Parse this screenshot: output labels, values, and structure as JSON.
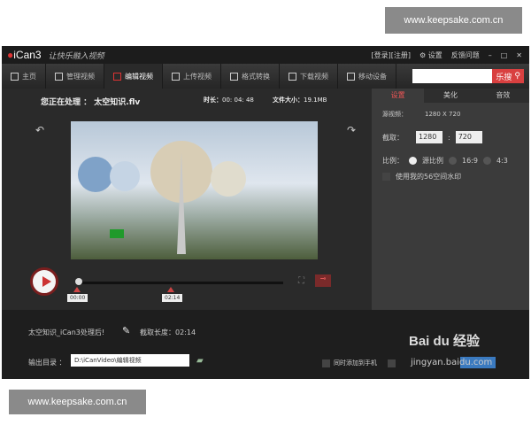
{
  "watermark_top": "www.keepsake.com.cn",
  "watermark_bottom": "www.keepsake.com.cn",
  "app": {
    "logo": "iCan3",
    "slogan": "让快乐融入视频",
    "login": "[登录]",
    "register": "[注册]",
    "settings": "设置",
    "feedback": "反馈问题"
  },
  "tabs": [
    {
      "label": "主页"
    },
    {
      "label": "管理视频"
    },
    {
      "label": "编辑视频"
    },
    {
      "label": "上传视频"
    },
    {
      "label": "格式转换"
    },
    {
      "label": "下载视频"
    },
    {
      "label": "移动设备"
    }
  ],
  "search": {
    "button": "乐搜",
    "value": ""
  },
  "info": {
    "processing_label": "您正在处理 ：",
    "file": "太空知识.flv",
    "duration_label": "时长：",
    "duration": "00: 04: 48",
    "size_label": "文件大小：",
    "size": "19.1MB"
  },
  "right_panel": {
    "tabs": [
      "设置",
      "美化",
      "音效"
    ],
    "source_label": "源视频：",
    "source": "1280 X 720",
    "crop_label": "截取：",
    "crop_w": "1280",
    "crop_h": "720",
    "ratio_label": "比例：",
    "ratios": [
      "源比例",
      "16:9",
      "4:3"
    ],
    "watermark_option": "使用我的56空间水印"
  },
  "timeline": {
    "start": "00:00",
    "end": "02:14"
  },
  "bottom": {
    "output_name": "太空知识_iCan3处理后!",
    "clip_length_label": "截取长度：",
    "clip_length": "02:14",
    "output_dir_label": "输出目录 ：",
    "output_dir": "D:\\iCanVideo\\编辑视频",
    "sync_label": "同时添加到手机",
    "baidu": "Bai du 经验",
    "baidu_url": "jingyan.baidu.com"
  }
}
